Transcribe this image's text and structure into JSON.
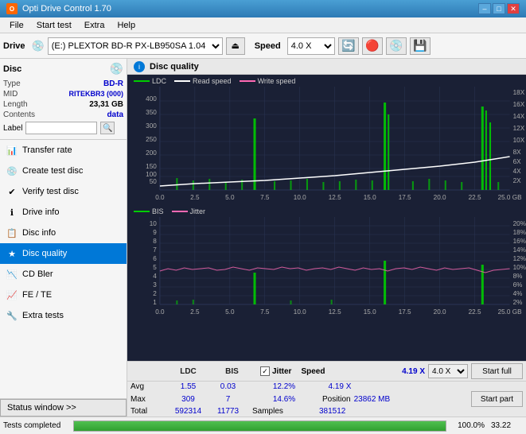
{
  "titleBar": {
    "appName": "Opti Drive Control 1.70",
    "iconText": "O",
    "btnMin": "–",
    "btnMax": "□",
    "btnClose": "✕"
  },
  "menuBar": {
    "items": [
      "File",
      "Start test",
      "Extra",
      "Help"
    ]
  },
  "toolbar": {
    "driveLabel": "Drive",
    "driveValue": "(E:)  PLEXTOR BD-R  PX-LB950SA 1.04",
    "speedLabel": "Speed",
    "speedValue": "4.0 X"
  },
  "discInfo": {
    "title": "Disc",
    "type": {
      "label": "Type",
      "value": "BD-R"
    },
    "mid": {
      "label": "MID",
      "value": "RITEKBR3 (000)"
    },
    "length": {
      "label": "Length",
      "value": "23,31 GB"
    },
    "contents": {
      "label": "Contents",
      "value": "data"
    },
    "labelLabel": "Label",
    "labelValue": ""
  },
  "navMenu": {
    "items": [
      {
        "id": "transfer-rate",
        "label": "Transfer rate",
        "icon": "📊"
      },
      {
        "id": "create-test-disc",
        "label": "Create test disc",
        "icon": "💿"
      },
      {
        "id": "verify-test-disc",
        "label": "Verify test disc",
        "icon": "✔"
      },
      {
        "id": "drive-info",
        "label": "Drive info",
        "icon": "ℹ"
      },
      {
        "id": "disc-info",
        "label": "Disc info",
        "icon": "📋"
      },
      {
        "id": "disc-quality",
        "label": "Disc quality",
        "icon": "★",
        "active": true
      },
      {
        "id": "cd-bler",
        "label": "CD Bler",
        "icon": "📉"
      },
      {
        "id": "fe-te",
        "label": "FE / TE",
        "icon": "📈"
      },
      {
        "id": "extra-tests",
        "label": "Extra tests",
        "icon": "🔧"
      }
    ]
  },
  "statusWindow": {
    "label": "Status window >>"
  },
  "chartHeader": {
    "title": "Disc quality"
  },
  "upperChart": {
    "title": "LDC",
    "legendItems": [
      {
        "label": "LDC",
        "color": "#00cc00"
      },
      {
        "label": "Read speed",
        "color": "#ffffff"
      },
      {
        "label": "Write speed",
        "color": "#ff69b4"
      }
    ],
    "yAxisLeft": [
      "400",
      "350",
      "300",
      "250",
      "200",
      "150",
      "100",
      "50"
    ],
    "yAxisRight": [
      "18X",
      "16X",
      "14X",
      "12X",
      "10X",
      "8X",
      "6X",
      "4X",
      "2X"
    ],
    "xAxis": [
      "0.0",
      "2.5",
      "5.0",
      "7.5",
      "10.0",
      "12.5",
      "15.0",
      "17.5",
      "20.0",
      "22.5",
      "25.0 GB"
    ]
  },
  "lowerChart": {
    "legendItems": [
      {
        "label": "BIS",
        "color": "#00cc00"
      },
      {
        "label": "Jitter",
        "color": "#ff69b4"
      }
    ],
    "yAxisLeft": [
      "10",
      "9",
      "8",
      "7",
      "6",
      "5",
      "4",
      "3",
      "2",
      "1"
    ],
    "yAxisRight": [
      "20%",
      "18%",
      "16%",
      "14%",
      "12%",
      "10%",
      "8%",
      "6%",
      "4%",
      "2%"
    ],
    "xAxis": [
      "0.0",
      "2.5",
      "5.0",
      "7.5",
      "10.0",
      "12.5",
      "15.0",
      "17.5",
      "20.0",
      "22.5",
      "25.0 GB"
    ]
  },
  "statsTable": {
    "headers": [
      "",
      "LDC",
      "BIS",
      "",
      "Jitter",
      "Speed",
      "",
      ""
    ],
    "rows": [
      {
        "label": "Avg",
        "ldc": "1.55",
        "bis": "0.03",
        "jitter": "12.2%",
        "speed": "4.19 X"
      },
      {
        "label": "Max",
        "ldc": "309",
        "bis": "7",
        "jitter": "14.6%",
        "position": "23862 MB"
      },
      {
        "label": "Total",
        "ldc": "592314",
        "bis": "11773",
        "samples": "381512"
      }
    ],
    "jitterLabel": "Jitter",
    "speedLabel": "Speed",
    "positionLabel": "Position",
    "samplesLabel": "Samples",
    "speedValue": "4.19 X",
    "speedDropdown": "4.0 X",
    "startFullBtn": "Start full",
    "startPartBtn": "Start part"
  },
  "progressBar": {
    "label": "Tests completed",
    "value": 100,
    "displayValue": "100.0%",
    "rightValue": "33.22"
  }
}
